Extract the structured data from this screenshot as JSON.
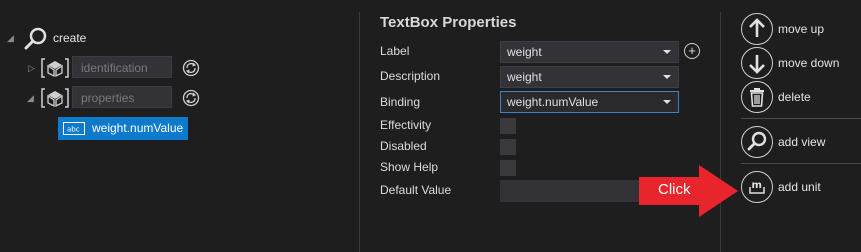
{
  "tree": {
    "root_label": "create",
    "nodes": [
      {
        "label": "identification"
      },
      {
        "label": "properties"
      }
    ],
    "selected_label": "weight.numValue",
    "selected_icon_text": "abc"
  },
  "properties": {
    "title": "TextBox Properties",
    "fields": {
      "label": {
        "name": "Label",
        "value": "weight"
      },
      "description": {
        "name": "Description",
        "value": "weight"
      },
      "binding": {
        "name": "Binding",
        "value": "weight.numValue"
      },
      "effectivity": {
        "name": "Effectivity"
      },
      "disabled": {
        "name": "Disabled"
      },
      "show_help": {
        "name": "Show Help"
      },
      "default_value": {
        "name": "Default Value",
        "value": ""
      }
    }
  },
  "toolbar": {
    "move_up": "move up",
    "move_down": "move down",
    "delete": "delete",
    "add_view": "add view",
    "add_unit": "add unit"
  },
  "callout": {
    "text": "Click",
    "color": "#e8242c"
  },
  "colors": {
    "background": "#1e1e1e",
    "selection": "#0e7acc",
    "field_bg": "#333337",
    "focus_border": "#3a84c8"
  }
}
